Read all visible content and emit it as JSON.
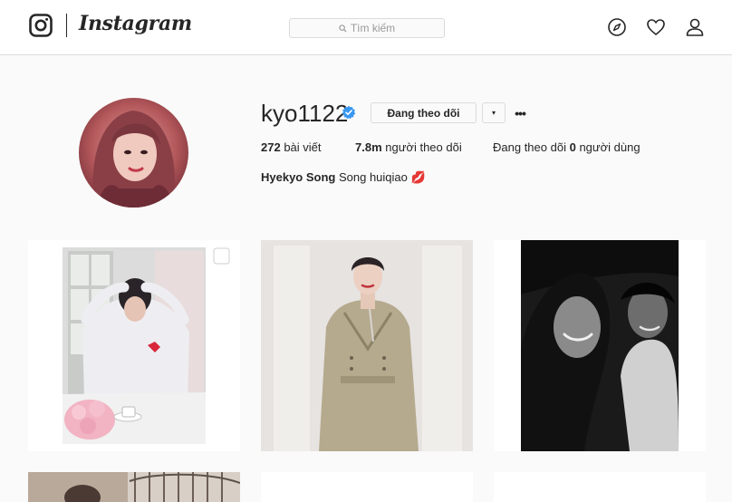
{
  "nav": {
    "wordmark": "Instagram",
    "search_placeholder": "Tìm kiếm",
    "icons": [
      "instagram-logo-icon",
      "search-icon",
      "compass-icon",
      "heart-icon",
      "user-icon"
    ]
  },
  "profile": {
    "username": "kyo1122",
    "verified": true,
    "follow_button_label": "Đang theo dõi",
    "dropdown_label": "▾",
    "more_label": "•••",
    "stats": {
      "posts_count": "272",
      "posts_label": "bài viết",
      "followers_count": "7.8m",
      "followers_label": "người theo dõi",
      "following_prefix": "Đang theo dõi",
      "following_count": "0",
      "following_suffix": "người dùng"
    },
    "bio": {
      "full_name": "Hyekyo Song",
      "text": "Song huiqiao",
      "emoji": "💋"
    }
  },
  "colors": {
    "background": "#fafafa",
    "border": "#dbdbdb",
    "text": "#262626",
    "verified_blue": "#3897f0"
  }
}
